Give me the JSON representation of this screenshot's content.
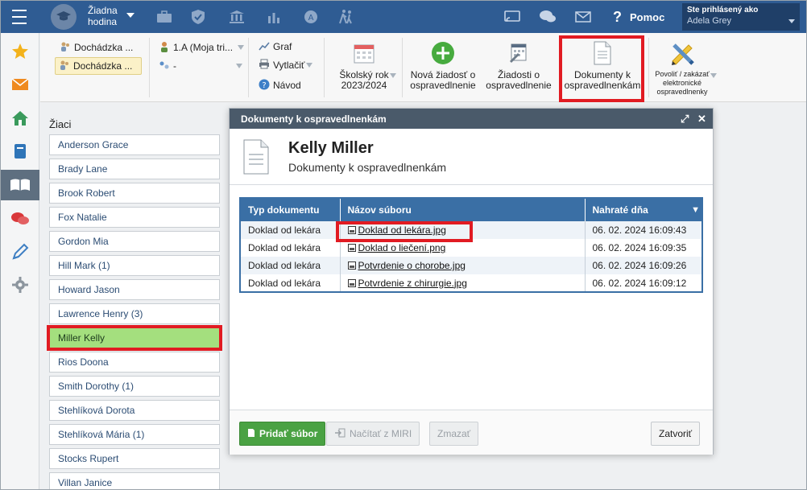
{
  "topbar": {
    "hour_line1": "Žiadna",
    "hour_line2": "hodina",
    "help_label": "Pomoc",
    "user_label": "Ste prihlásený ako",
    "user_name": "Adela Grey"
  },
  "toolbar": {
    "selector_top": "Dochádzka ...",
    "selector_selected": "Dochádzka ...",
    "class_label": "1.A (Moja tri...",
    "group_label": "-",
    "graph_label": "Graf",
    "print_label": "Vytlačiť",
    "guide_label": "Návod",
    "school_year_line1": "Školský rok",
    "school_year_line2": "2023/2024",
    "new_request_line1": "Nová žiadosť o",
    "new_request_line2": "ospravedlnenie",
    "requests_line1": "Žiadosti o",
    "requests_line2": "ospravedlnenie",
    "documents_line1": "Dokumenty k",
    "documents_line2": "ospravedlnenkám",
    "allow_line1": "Povoliť / zakázať",
    "allow_line2": "elektronické",
    "allow_line3": "ospravedlnenky"
  },
  "students": {
    "title": "Žiaci",
    "items": [
      "Anderson Grace",
      "Brady Lane",
      "Brook Robert",
      "Fox Natalie",
      "Gordon Mia",
      "Hill Mark (1)",
      "Howard Jason",
      "Lawrence Henry (3)",
      "Miller Kelly",
      "Rios Doona",
      "Smith Dorothy (1)",
      "Stehlíková Dorota",
      "Stehlíková Mária (1)",
      "Stocks Rupert",
      "Villan Janice"
    ],
    "selected_index": 8
  },
  "modal": {
    "title": "Dokumenty k ospravedlnenkám",
    "student_name": "Kelly Miller",
    "subtitle": "Dokumenty k ospravedlnenkám",
    "columns": [
      "Typ dokumentu",
      "Názov súboru",
      "Nahraté dňa"
    ],
    "rows": [
      {
        "type": "Doklad od lekára",
        "file": "Doklad od lekára.jpg",
        "uploaded": "06. 02. 2024 16:09:43"
      },
      {
        "type": "Doklad od lekára",
        "file": "Doklad o liečení.png",
        "uploaded": "06. 02. 2024 16:09:35"
      },
      {
        "type": "Doklad od lekára",
        "file": "Potvrdenie o chorobe.jpg",
        "uploaded": "06. 02. 2024 16:09:26"
      },
      {
        "type": "Doklad od lekára",
        "file": "Potvrdenie z chirurgie.jpg",
        "uploaded": "06. 02. 2024 16:09:12"
      }
    ],
    "add_button": "Pridať súbor",
    "miri_button": "Načítať z MIRI",
    "delete_button": "Zmazať",
    "close_button": "Zatvoriť"
  },
  "colors": {
    "topbar": "#2f5c93",
    "table_header": "#3a6fa5",
    "highlight": "#e11b22",
    "selected_student": "#a4df7e",
    "add_button": "#4aa243"
  }
}
